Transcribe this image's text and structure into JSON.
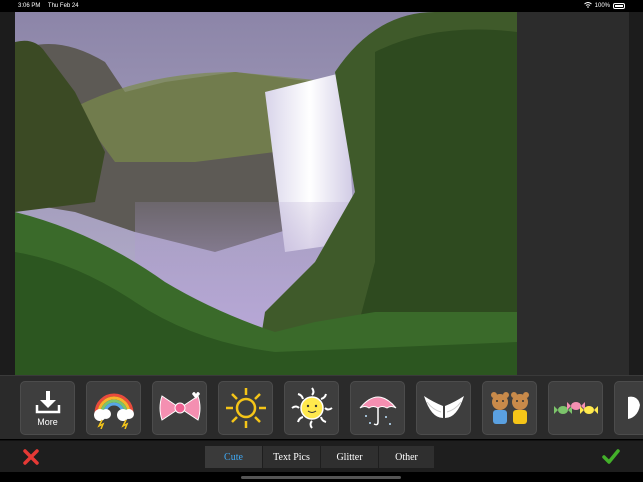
{
  "status": {
    "time": "3:06 PM",
    "date": "Thu Feb 24",
    "battery": "100%"
  },
  "stickers": {
    "more_label": "More",
    "items": [
      {
        "name": "download-more-icon"
      },
      {
        "name": "rainbow-clouds-sticker"
      },
      {
        "name": "pink-bow-sticker"
      },
      {
        "name": "sun-doodle-sticker"
      },
      {
        "name": "smiling-sun-sticker"
      },
      {
        "name": "pink-umbrella-sticker"
      },
      {
        "name": "angel-wings-sticker"
      },
      {
        "name": "teddy-bears-sticker"
      },
      {
        "name": "candies-sticker"
      }
    ]
  },
  "tabs": [
    {
      "label": "Cute",
      "active": true
    },
    {
      "label": "Text Pics",
      "active": false
    },
    {
      "label": "Glitter",
      "active": false
    },
    {
      "label": "Other",
      "active": false
    }
  ],
  "colors": {
    "active_tab": "#3fa9f5",
    "cancel": "#e53935",
    "confirm": "#43b02a",
    "background": "#000000"
  },
  "icons": {
    "cancel": "red-x-icon",
    "confirm": "green-check-icon"
  }
}
